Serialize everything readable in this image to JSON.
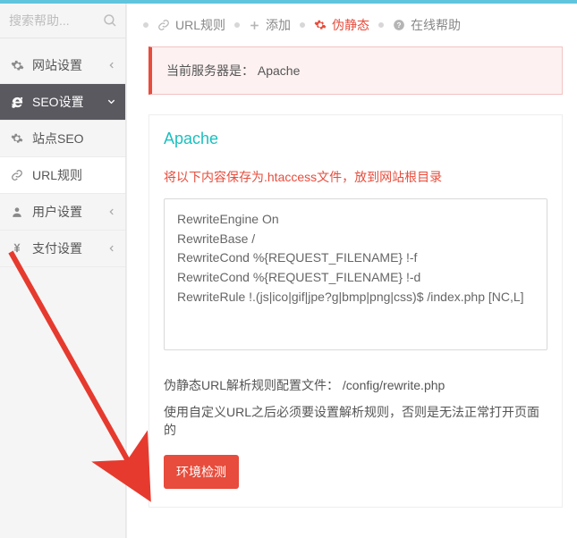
{
  "search": {
    "placeholder": "搜索帮助..."
  },
  "sidebar": {
    "items": [
      {
        "label": "网站设置"
      },
      {
        "label": "SEO设置"
      },
      {
        "label": "站点SEO"
      },
      {
        "label": "URL规则"
      },
      {
        "label": "用户设置"
      },
      {
        "label": "支付设置"
      }
    ]
  },
  "tabs": {
    "items": [
      {
        "label": "URL规则"
      },
      {
        "label": "添加"
      },
      {
        "label": "伪静态"
      },
      {
        "label": "在线帮助"
      }
    ]
  },
  "alert": {
    "prefix": "当前服务器是：",
    "server": "Apache"
  },
  "panel": {
    "title": "Apache",
    "instruction": "将以下内容保存为.htaccess文件，放到网站根目录",
    "code": "RewriteEngine On\nRewriteBase /\nRewriteCond %{REQUEST_FILENAME} !-f\nRewriteCond %{REQUEST_FILENAME} !-d\nRewriteRule !.(js|ico|gif|jpe?g|bmp|png|css)$ /index.php [NC,L]",
    "config_line_prefix": "伪静态URL解析规则配置文件：",
    "config_path": "/config/rewrite.php",
    "note": "使用自定义URL之后必须要设置解析规则，否则是无法正常打开页面的",
    "button": "环境检测"
  }
}
